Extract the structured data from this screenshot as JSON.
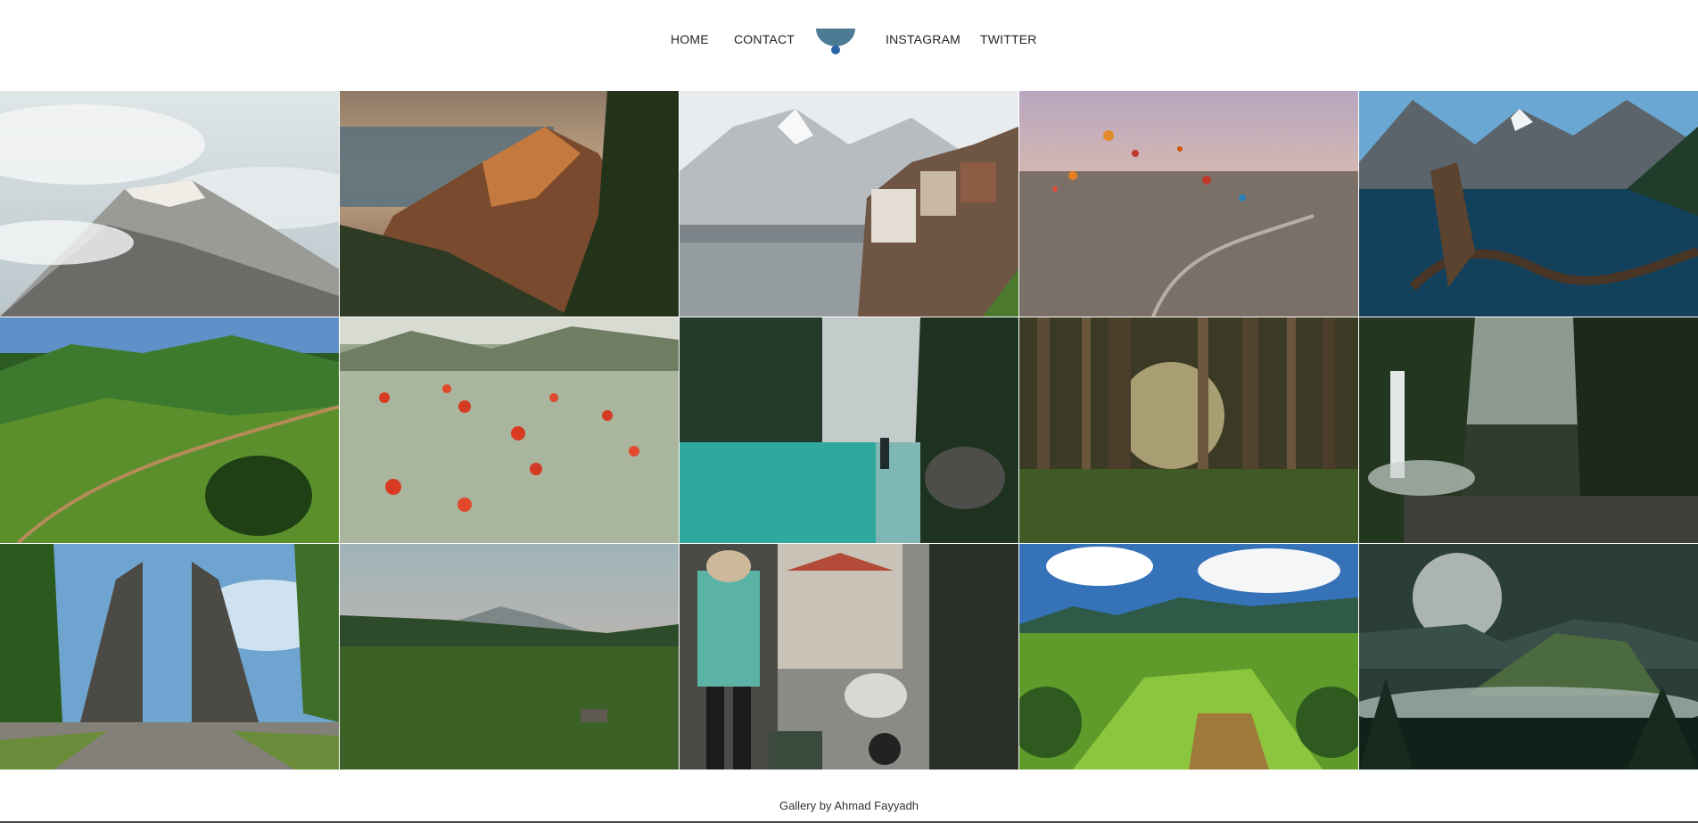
{
  "nav": {
    "home": "HOME",
    "contact": "CONTACT",
    "instagram": "INSTAGRAM",
    "twitter": "TWITTER",
    "logo_icon": "half-moon-logo-icon",
    "logo_color": "#4d7a95",
    "logo_dot_color": "#2d63a8"
  },
  "gallery": {
    "photos": [
      "snowy-mountain-peak-clouds",
      "coastal-cliffs-sunset",
      "alpine-lakeside-village",
      "hot-air-balloons-valley",
      "mountain-lake-driftwood",
      "green-hills-road",
      "poppy-field",
      "turquoise-river-hiker",
      "sunlit-forest",
      "waterfall-gorge",
      "temple-gate",
      "rice-fields-volcano-dusk",
      "street-vendor-scooters",
      "terraced-valley-clouds",
      "volcano-mist-dark"
    ]
  },
  "footer": {
    "credit": "Gallery by Ahmad Fayyadh"
  }
}
